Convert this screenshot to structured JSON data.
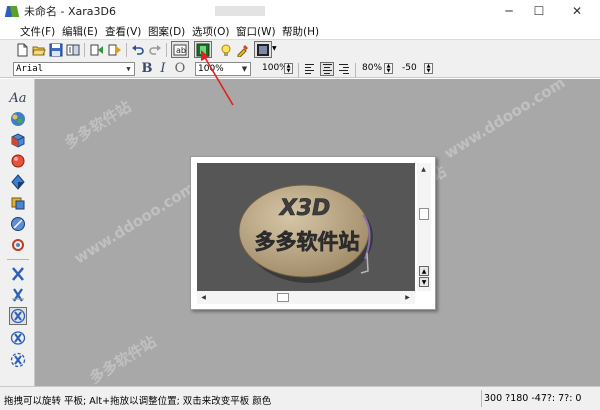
{
  "window": {
    "title": "未命名 - Xara3D6",
    "minimize": "─",
    "maximize": "☐",
    "close": "✕"
  },
  "menu": {
    "items": [
      "文件(F)",
      "编辑(E)",
      "查看(V)",
      "图案(D)",
      "选项(O)",
      "窗口(W)",
      "帮助(H)"
    ]
  },
  "toolbar_main": {
    "icons": [
      "new-file-icon",
      "open-folder-icon",
      "save-icon",
      "export-icon",
      "text-options-icon",
      "animation-icon",
      "undo-icon",
      "redo-icon",
      "text-mode-icon",
      "shape-mode-icon",
      "light-icon",
      "color-picker-icon",
      "frame-icon"
    ],
    "pressed": [
      "text-mode-icon",
      "shape-mode-icon"
    ]
  },
  "toolbar_format": {
    "font": "Arial",
    "bold": "B",
    "italic": "I",
    "outline": "O",
    "zoom": "100%",
    "scale": "100%",
    "align_selected": "center",
    "spacing": "80%",
    "kerning": "-50"
  },
  "left_tools": [
    "text-tool-icon",
    "color-tool-icon",
    "extrude-tool-icon",
    "bevel-tool-icon",
    "shadow-tool-icon",
    "texture-tool-icon",
    "lighting-tool-icon",
    "rotate-tool-icon",
    "x-tool-icon",
    "anim-tool-icon",
    "spin-tool-icon",
    "swing-tool-icon",
    "pulse-tool-icon"
  ],
  "canvas": {
    "text_line1": "X3D",
    "text_line2": "多多软件站",
    "oval_color": "#b7a383",
    "background_color": "#565656"
  },
  "watermarks": [
    "多多软件站",
    "www.ddooo.com",
    "多多软件站",
    "www.ddooo.com",
    "多多软件站"
  ],
  "status": {
    "message": "拖拽可以旋转 平板; Alt+拖放以调整位置; 双击来改变平板 颜色",
    "coords": "300 ?180  -47?: 7?: 0"
  }
}
